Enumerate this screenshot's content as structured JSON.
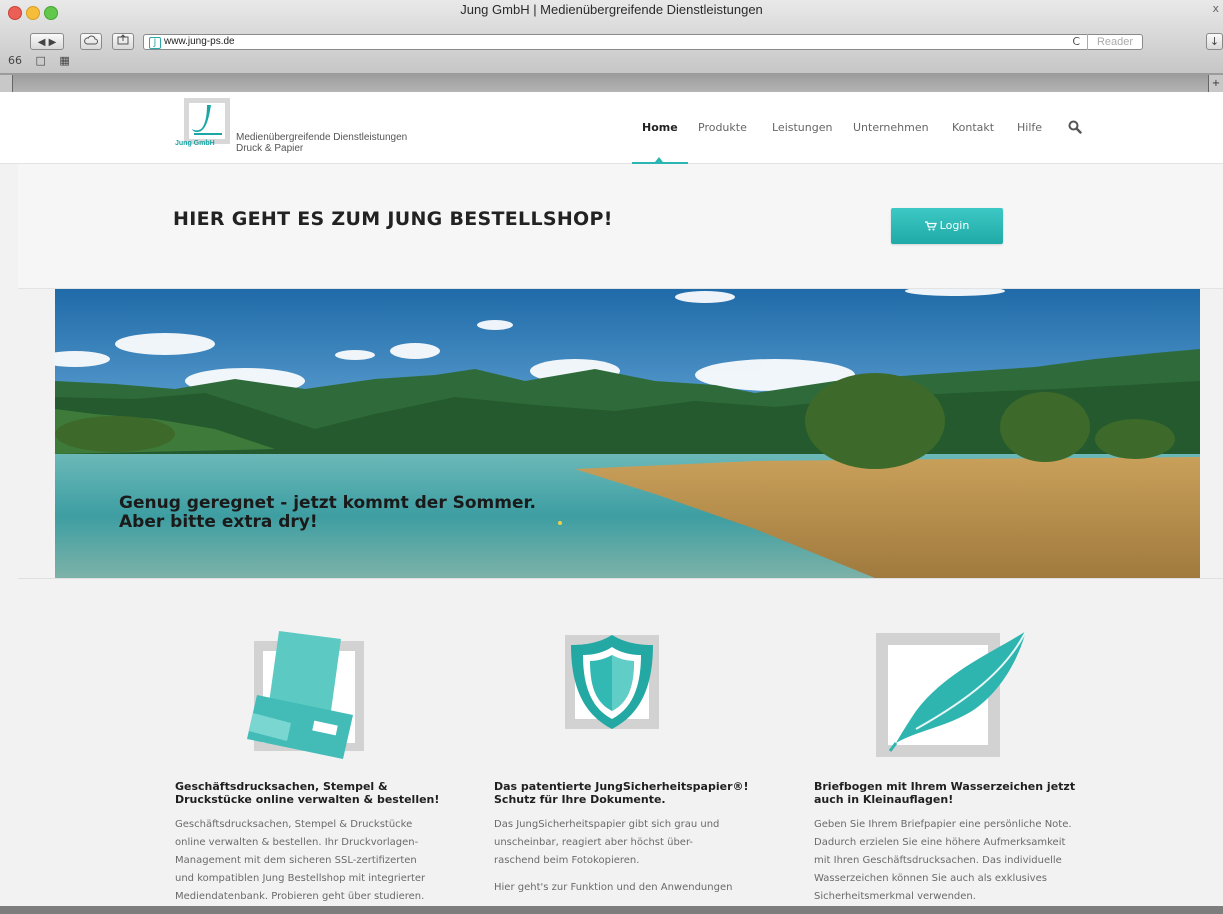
{
  "window": {
    "title": "Jung GmbH | Medienübergreifende Dienstleistungen",
    "close_glyph": "x"
  },
  "toolbar": {
    "back_glyph": "◀",
    "forward_glyph": "▶",
    "url": "www.jung-ps.de",
    "reload_glyph": "C",
    "reader_label": "Reader"
  },
  "bookmarks": [
    "66",
    "□",
    "▦"
  ],
  "site": {
    "logo_sub": "Jung GmbH",
    "tagline_line1": "Medienübergreifende Dienstleistungen",
    "tagline_line2": "Druck & Papier",
    "nav": [
      "Home",
      "Produkte",
      "Leistungen",
      "Unternehmen",
      "Kontakt",
      "Hilfe"
    ],
    "nav_active": "Home",
    "accent_color": "#2bb6b3"
  },
  "promo": {
    "title": "HIER GEHT ES ZUM JUNG BESTELLSHOP!",
    "login_label": "Login"
  },
  "hero": {
    "line1": "Genug geregnet - jetzt kommt der Sommer.",
    "line2": "Aber bitte extra dry!"
  },
  "features": [
    {
      "icon": "envelope-stationery-icon",
      "title_line1": "Geschäftsdrucksachen, Stempel &",
      "title_line2": "Druckstücke online verwalten & bestellen!",
      "text_lines": [
        "Geschäftsdrucksachen, Stempel & Druckstücke",
        "online verwalten & bestellen. Ihr Druckvorlagen-",
        "Management mit dem sicheren SSL-zertifizerten",
        "und kompatiblen Jung Bestellshop mit integrierter",
        "Mediendatenbank. Probieren geht über studieren."
      ]
    },
    {
      "icon": "shield-icon",
      "title_line1": "Das patentierte JungSicherheitspapier®!",
      "title_line2": "Schutz für Ihre Dokumente.",
      "text_lines": [
        "Das JungSicherheitspapier gibt sich grau und",
        "unscheinbar, reagiert aber höchst über-",
        "raschend beim Fotokopieren."
      ],
      "link": "Hier geht's zur Funktion und den Anwendungen"
    },
    {
      "icon": "feather-icon",
      "title_line1": "Briefbogen mit Ihrem Wasserzeichen jetzt",
      "title_line2": "auch in Kleinauflagen!",
      "text_lines": [
        "Geben Sie Ihrem Briefpapier eine persönliche Note.",
        "Dadurch erzielen Sie eine höhere Aufmerksamkeit",
        "mit Ihren Geschäftsdrucksachen. Das individuelle",
        "Wasserzeichen können Sie auch als exklusives",
        "Sicherheitsmerkmal verwenden."
      ]
    }
  ]
}
